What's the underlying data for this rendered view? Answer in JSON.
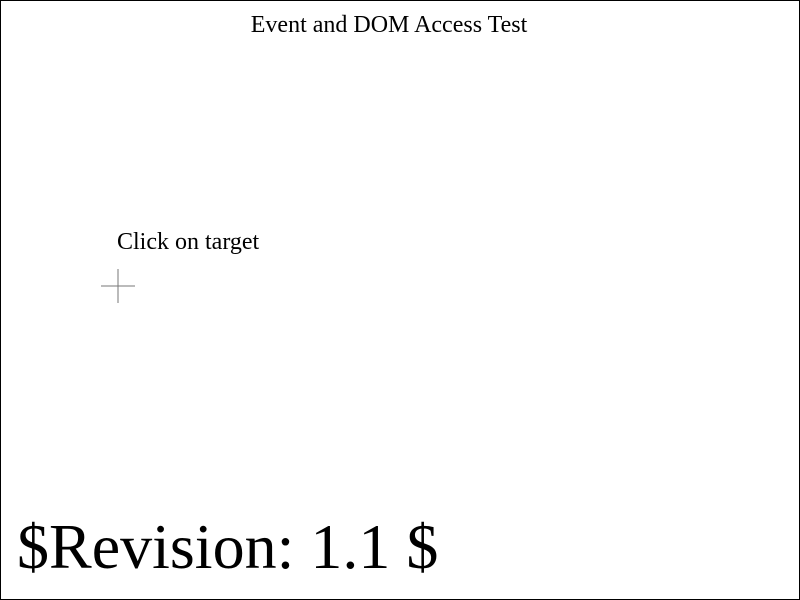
{
  "page": {
    "title": "Event and DOM Access Test",
    "instruction": "Click on target",
    "revision": "$Revision: 1.1 $"
  },
  "target": {
    "icon": "crosshair-icon",
    "color": "#777777"
  }
}
